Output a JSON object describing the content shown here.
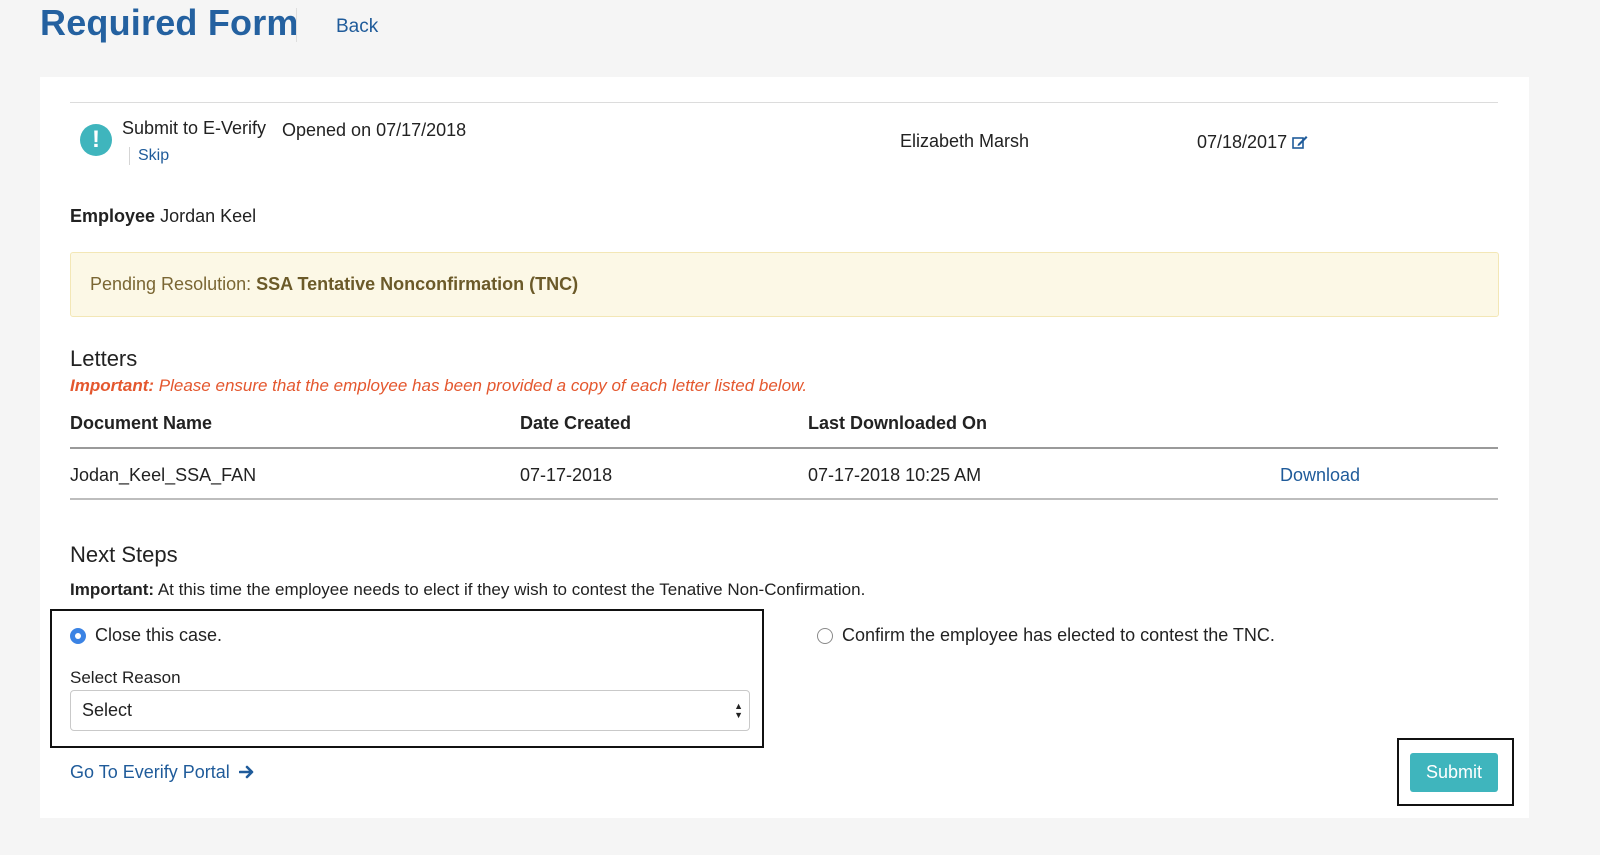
{
  "header": {
    "title": "Required Form",
    "back_label": "Back"
  },
  "task": {
    "name": "Submit to E-Verify",
    "skip_label": "Skip",
    "opened_on": "Opened on 07/17/2018",
    "assignee": "Elizabeth Marsh",
    "due_date": "07/18/2017"
  },
  "employee": {
    "label": "Employee",
    "name": "Jordan Keel"
  },
  "pending": {
    "label": "Pending Resolution:",
    "value": "SSA Tentative Nonconfirmation (TNC)"
  },
  "letters": {
    "title": "Letters",
    "important_label": "Important:",
    "important_text": "Please ensure that the employee has been provided a copy of each letter listed below.",
    "columns": [
      "Document Name",
      "Date Created",
      "Last Downloaded On"
    ],
    "rows": [
      {
        "document_name": "Jodan_Keel_SSA_FAN",
        "date_created": "07-17-2018",
        "last_downloaded": "07-17-2018 10:25 AM",
        "action": "Download"
      }
    ]
  },
  "next_steps": {
    "title": "Next Steps",
    "important_label": "Important:",
    "important_text": "At this time the employee needs to elect if they wish to contest the Tenative Non-Confirmation.",
    "options": [
      {
        "label": "Close this case.",
        "selected": true
      },
      {
        "label": "Confirm the employee has elected to contest the TNC.",
        "selected": false
      }
    ],
    "reason_label": "Select Reason",
    "reason_value": "Select"
  },
  "footer": {
    "portal_link": "Go To Everify Portal",
    "submit_label": "Submit"
  },
  "colors": {
    "accent": "#3fb5bd",
    "link": "#1f5b9a",
    "title": "#2461a0",
    "warning_text": "#e4572e"
  }
}
